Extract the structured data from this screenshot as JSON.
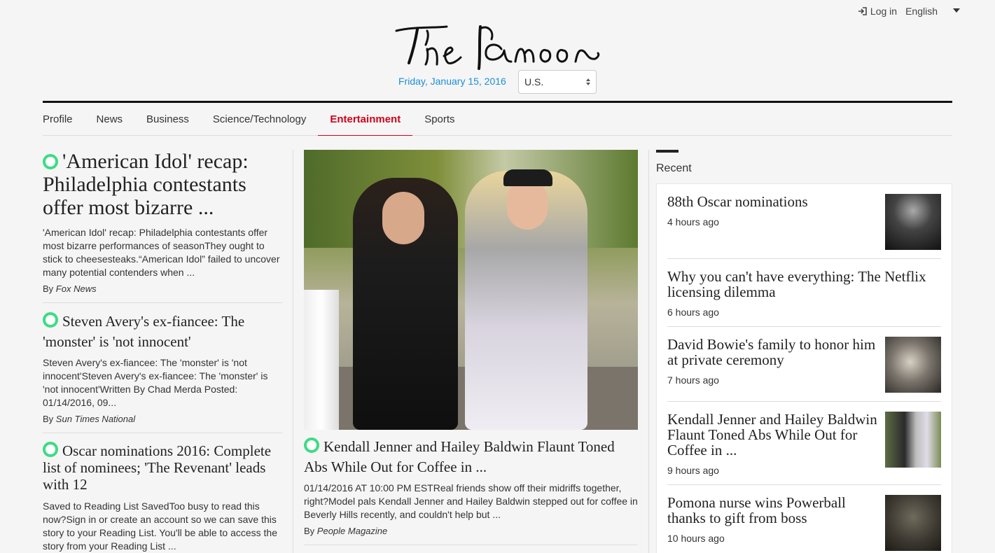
{
  "topbar": {
    "login_label": "Log in",
    "language": "English"
  },
  "brand": {
    "name": "The Damoon"
  },
  "dateline": {
    "date": "Friday, January 15, 2016",
    "region": "U.S."
  },
  "nav": {
    "items": [
      {
        "label": "Profile"
      },
      {
        "label": "News"
      },
      {
        "label": "Business"
      },
      {
        "label": "Science/Technology"
      },
      {
        "label": "Entertainment",
        "active": true
      },
      {
        "label": "Sports"
      }
    ]
  },
  "left_stories": [
    {
      "headline": "'American Idol' recap: Philadelphia contestants offer most bizarre ...",
      "summary": "'American Idol' recap: Philadelphia contestants offer most bizarre performances of seasonThey ought to stick to cheesesteaks.“American Idol” failed to uncover many potential contenders when ...",
      "by": "By",
      "source": "Fox News"
    },
    {
      "headline": "Steven Avery's ex-fiancee: The 'monster' is 'not innocent'",
      "summary": "Steven Avery's ex-fiancee: The 'monster' is 'not innocent'Steven Avery's ex-fiancee: The 'monster' is 'not innocent'Written By Chad Merda Posted: 01/14/2016, 09...",
      "by": "By",
      "source": "Sun Times National"
    },
    {
      "headline": "Oscar nominations 2016: Complete list of nominees; 'The Revenant' leads with 12",
      "summary": "Saved to Reading List SavedToo busy to read this now?Sign in or create an account so we can save this story to your Reading List. You'll be able to access the story from your Reading List ..."
    }
  ],
  "featured": {
    "headline": "Kendall Jenner and Hailey Baldwin Flaunt Toned Abs While Out for Coffee in ...",
    "summary": "01/14/2016 AT 10:00 PM ESTReal friends show off their midriffs together, right?Model pals Kendall Jenner and Hailey Baldwin stepped out for coffee in Beverly Hills recently, and couldn't help but ...",
    "by": "By",
    "source": "People Magazine"
  },
  "recent": {
    "label": "Recent",
    "items": [
      {
        "title": "88th Oscar nominations",
        "time": "4 hours ago",
        "thumb": "oscar-photo"
      },
      {
        "title": "Why you can't have everything: The Netflix licensing dilemma",
        "time": "6 hours ago"
      },
      {
        "title": "David Bowie's family to honor him at private ceremony",
        "time": "7 hours ago",
        "thumb": "bowie-photo"
      },
      {
        "title": "Kendall Jenner and Hailey Baldwin Flaunt Toned Abs While Out for Coffee in ...",
        "time": "9 hours ago",
        "thumb": "jenner-photo"
      },
      {
        "title": "Pomona nurse wins Powerball thanks to gift from boss",
        "time": "10 hours ago",
        "thumb": "crowd-photo"
      }
    ]
  },
  "colors": {
    "accent_red": "#d0021b",
    "link_blue": "#1a8fd6",
    "ring_green": "#3ddc84"
  }
}
